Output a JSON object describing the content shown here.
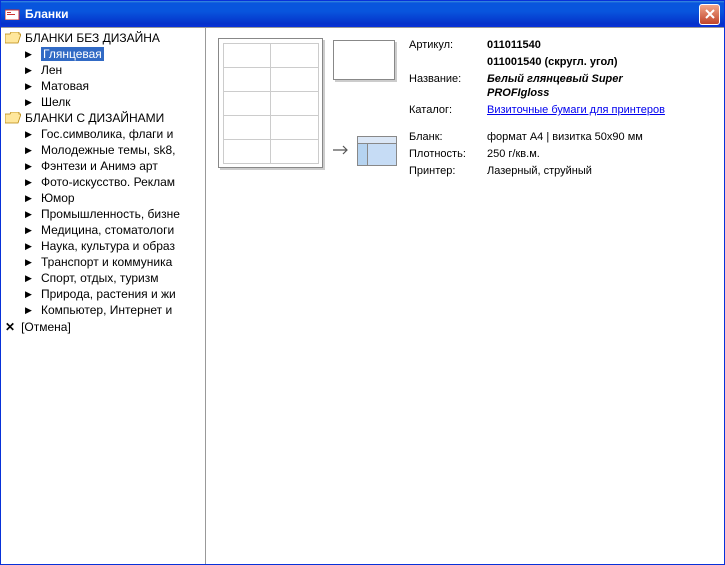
{
  "window": {
    "title": "Бланки"
  },
  "sidebar": {
    "group1": {
      "label": "БЛАНКИ БЕЗ ДИЗАЙНА",
      "items": [
        {
          "label": "Глянцевая",
          "selected": true
        },
        {
          "label": "Лен"
        },
        {
          "label": "Матовая"
        },
        {
          "label": "Шелк"
        }
      ]
    },
    "group2": {
      "label": "БЛАНКИ С ДИЗАЙНАМИ",
      "items": [
        {
          "label": "Гос.символика, флаги и"
        },
        {
          "label": "Молодежные темы, sk8,"
        },
        {
          "label": "Фэнтези и Анимэ арт"
        },
        {
          "label": "Фото-искусство. Реклам"
        },
        {
          "label": "Юмор"
        },
        {
          "label": "Промышленность, бизне"
        },
        {
          "label": "Медицина, стоматологи"
        },
        {
          "label": "Наука, культура и образ"
        },
        {
          "label": "Транспорт и коммуника"
        },
        {
          "label": "Спорт, отдых, туризм"
        },
        {
          "label": "Природа, растения и жи"
        },
        {
          "label": "Компьютер, Интернет и"
        }
      ]
    },
    "cancel": "[Отмена]"
  },
  "details": {
    "articul_label": "Артикул:",
    "articul_line1": "011011540",
    "articul_line2": "011001540 (скругл. угол)",
    "name_label": "Название:",
    "name_value": "Белый глянцевый Super PROFIgloss",
    "catalog_label": "Каталог:",
    "catalog_link": "Визиточные бумаги для принтеров",
    "blank_label": "Бланк:",
    "blank_value": "формат А4 | визитка 50x90 мм",
    "density_label": "Плотность:",
    "density_value": "250 г/кв.м.",
    "printer_label": "Принтер:",
    "printer_value": "Лазерный, струйный"
  }
}
